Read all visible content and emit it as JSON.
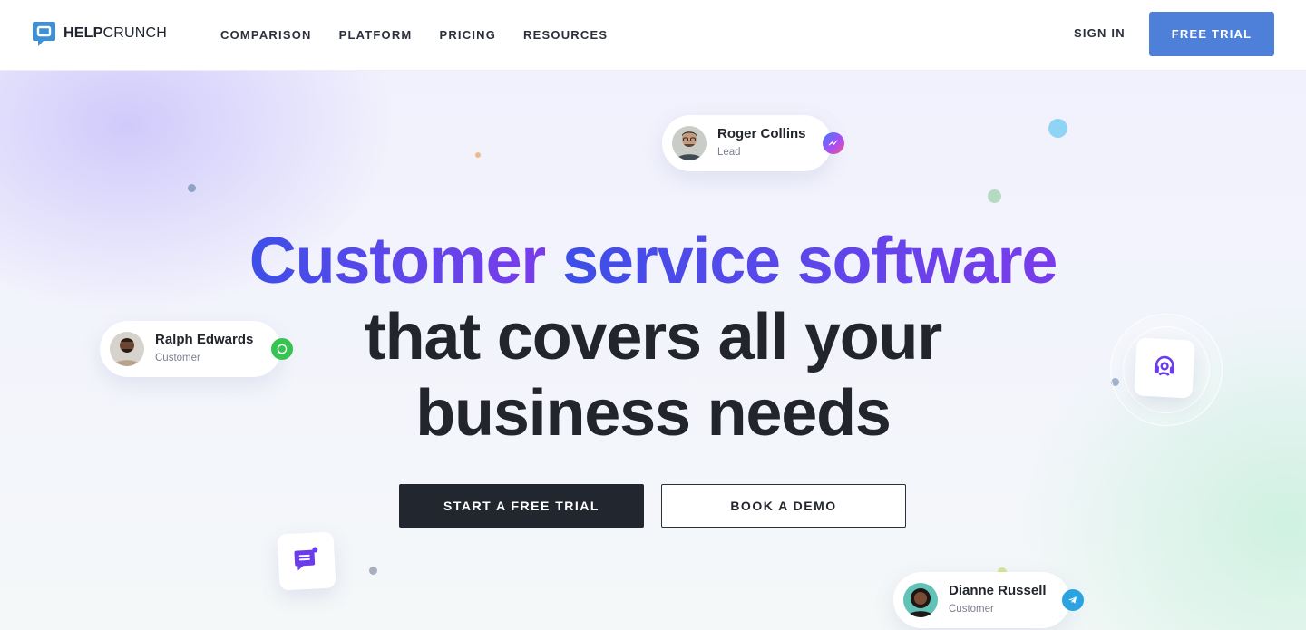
{
  "brand": {
    "bold": "HELP",
    "light": "CRUNCH"
  },
  "nav": {
    "items": [
      {
        "label": "COMPARISON"
      },
      {
        "label": "PLATFORM"
      },
      {
        "label": "PRICING"
      },
      {
        "label": "RESOURCES"
      }
    ],
    "sign_in": "SIGN IN",
    "free_trial": "FREE TRIAL"
  },
  "hero": {
    "headline": {
      "line1_word1": "Customer",
      "line1_rest": "service software",
      "line2": "that covers all your",
      "line3": "business needs"
    },
    "cta_primary": "START A FREE TRIAL",
    "cta_secondary": "BOOK A DEMO"
  },
  "contacts": [
    {
      "name": "Roger Collins",
      "role": "Lead",
      "channel_icon": "messenger-icon"
    },
    {
      "name": "Ralph Edwards",
      "role": "Customer",
      "channel_icon": "whatsapp-icon"
    },
    {
      "name": "Dianne Russell",
      "role": "Customer",
      "channel_icon": "telegram-icon"
    }
  ],
  "colors": {
    "accent_button": "#4f80d9",
    "dark_button": "#22262e",
    "gradient_start": "#3d4fe8",
    "gradient_end": "#7a3cea",
    "text_dark": "#22252c"
  }
}
